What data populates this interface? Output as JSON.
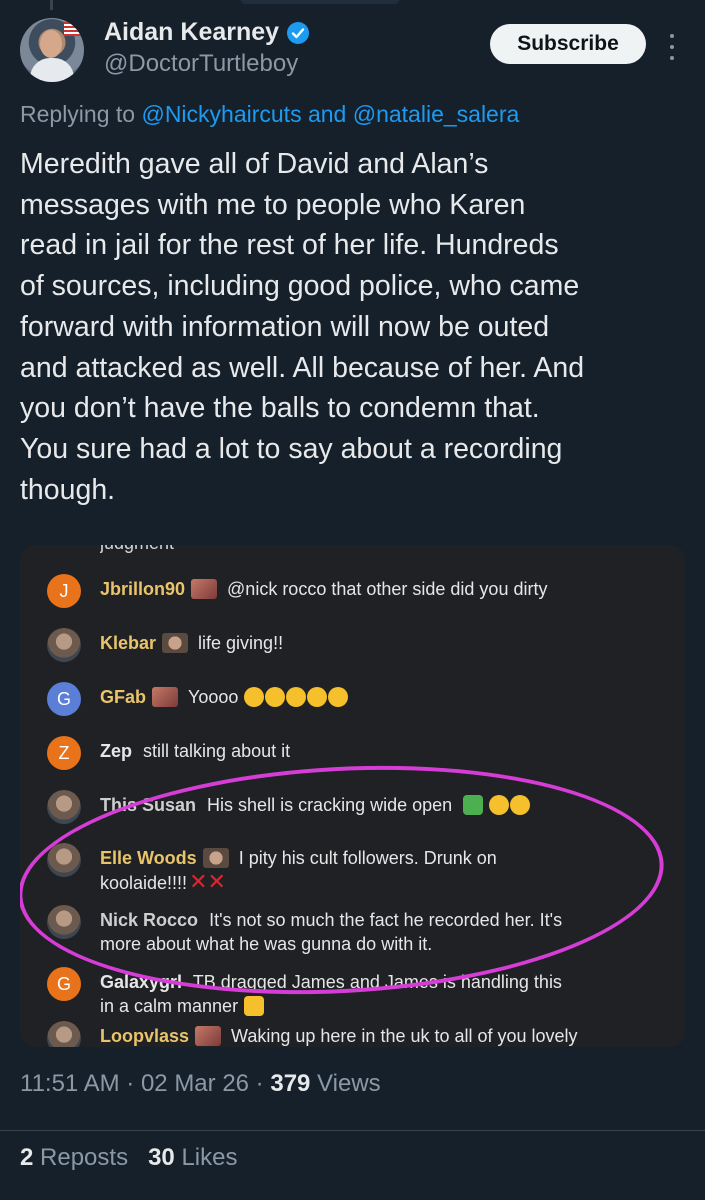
{
  "author": {
    "display_name": "Aidan Kearney",
    "handle": "@DoctorTurtleboy",
    "verified_icon": "verified-badge-icon",
    "avatar_icon": "profile-photo"
  },
  "subscribe_label": "Subscribe",
  "more_icon": "more-vertical-icon",
  "replying": {
    "prefix": "Replying to ",
    "mention1": "@Nickyhaircuts",
    "and": " and ",
    "mention2": "@natalie_salera"
  },
  "tweet_text": "Meredith gave all of David and Alan’s\nmessages with me to people who Karen\nread in jail for the rest of her life. Hundreds\nof sources, including good police, who came\nforward with information will now be outed\nand attacked as well. All because of her. And\nyou don’t have the balls to condemn that.\nYou sure had a lot to say about a recording\nthough.",
  "chat": {
    "partial_top": "judgment",
    "rows": [
      {
        "initial": "J",
        "user": "Jbrillon90",
        "user_color": "#e9c46a",
        "avatar_color": "#e8731a",
        "text": "@nick rocco that other side did you dirty"
      },
      {
        "initial": "",
        "user": "Klebar",
        "user_color": "#e9c46a",
        "avatar_color": "photo",
        "text": "life giving!!"
      },
      {
        "initial": "G",
        "user": "GFab",
        "user_color": "#e9c46a",
        "avatar_color": "#5b7ed6",
        "text": "Yoooo"
      },
      {
        "initial": "Z",
        "user": "Zep",
        "user_color": "#e6e6e6",
        "avatar_color": "#e8731a",
        "text": "still talking about it"
      },
      {
        "initial": "",
        "user": "This Susan",
        "user_color": "#cfcfcf",
        "avatar_color": "photo",
        "text": "His shell is cracking wide open"
      },
      {
        "initial": "",
        "user": "Elle Woods",
        "user_color": "#e9c46a",
        "avatar_color": "photo",
        "text": "I pity his cult followers. Drunk on",
        "text2": "koolaide!!!!"
      },
      {
        "initial": "",
        "user": "Nick Rocco",
        "user_color": "#cfcfcf",
        "avatar_color": "photo",
        "text": "It's not so much the fact he recorded her. It's",
        "text2": "more about what he was gunna do with it."
      },
      {
        "initial": "G",
        "user": "Galaxygrl",
        "user_color": "#e6e6e6",
        "avatar_color": "#e8731a",
        "text": "TB dragged James and James is handling this",
        "text2": "in a calm manner"
      },
      {
        "initial": "",
        "user": "Loopvlass",
        "user_color": "#e9c46a",
        "avatar_color": "photo",
        "text": "Waking up here in the uk to all of you lovely"
      }
    ],
    "highlight_color": "#d63cd6"
  },
  "meta": {
    "time": "11:51 AM",
    "sep": " · ",
    "date": "02 Mar 26",
    "views_count": "379",
    "views_label": " Views"
  },
  "stats": {
    "reposts_count": "2",
    "reposts_label": " Reposts",
    "likes_count": "30",
    "likes_label": " Likes"
  },
  "colors": {
    "background": "#15202b",
    "accent": "#1d9bf0",
    "secondary_text": "#8b98a5"
  }
}
